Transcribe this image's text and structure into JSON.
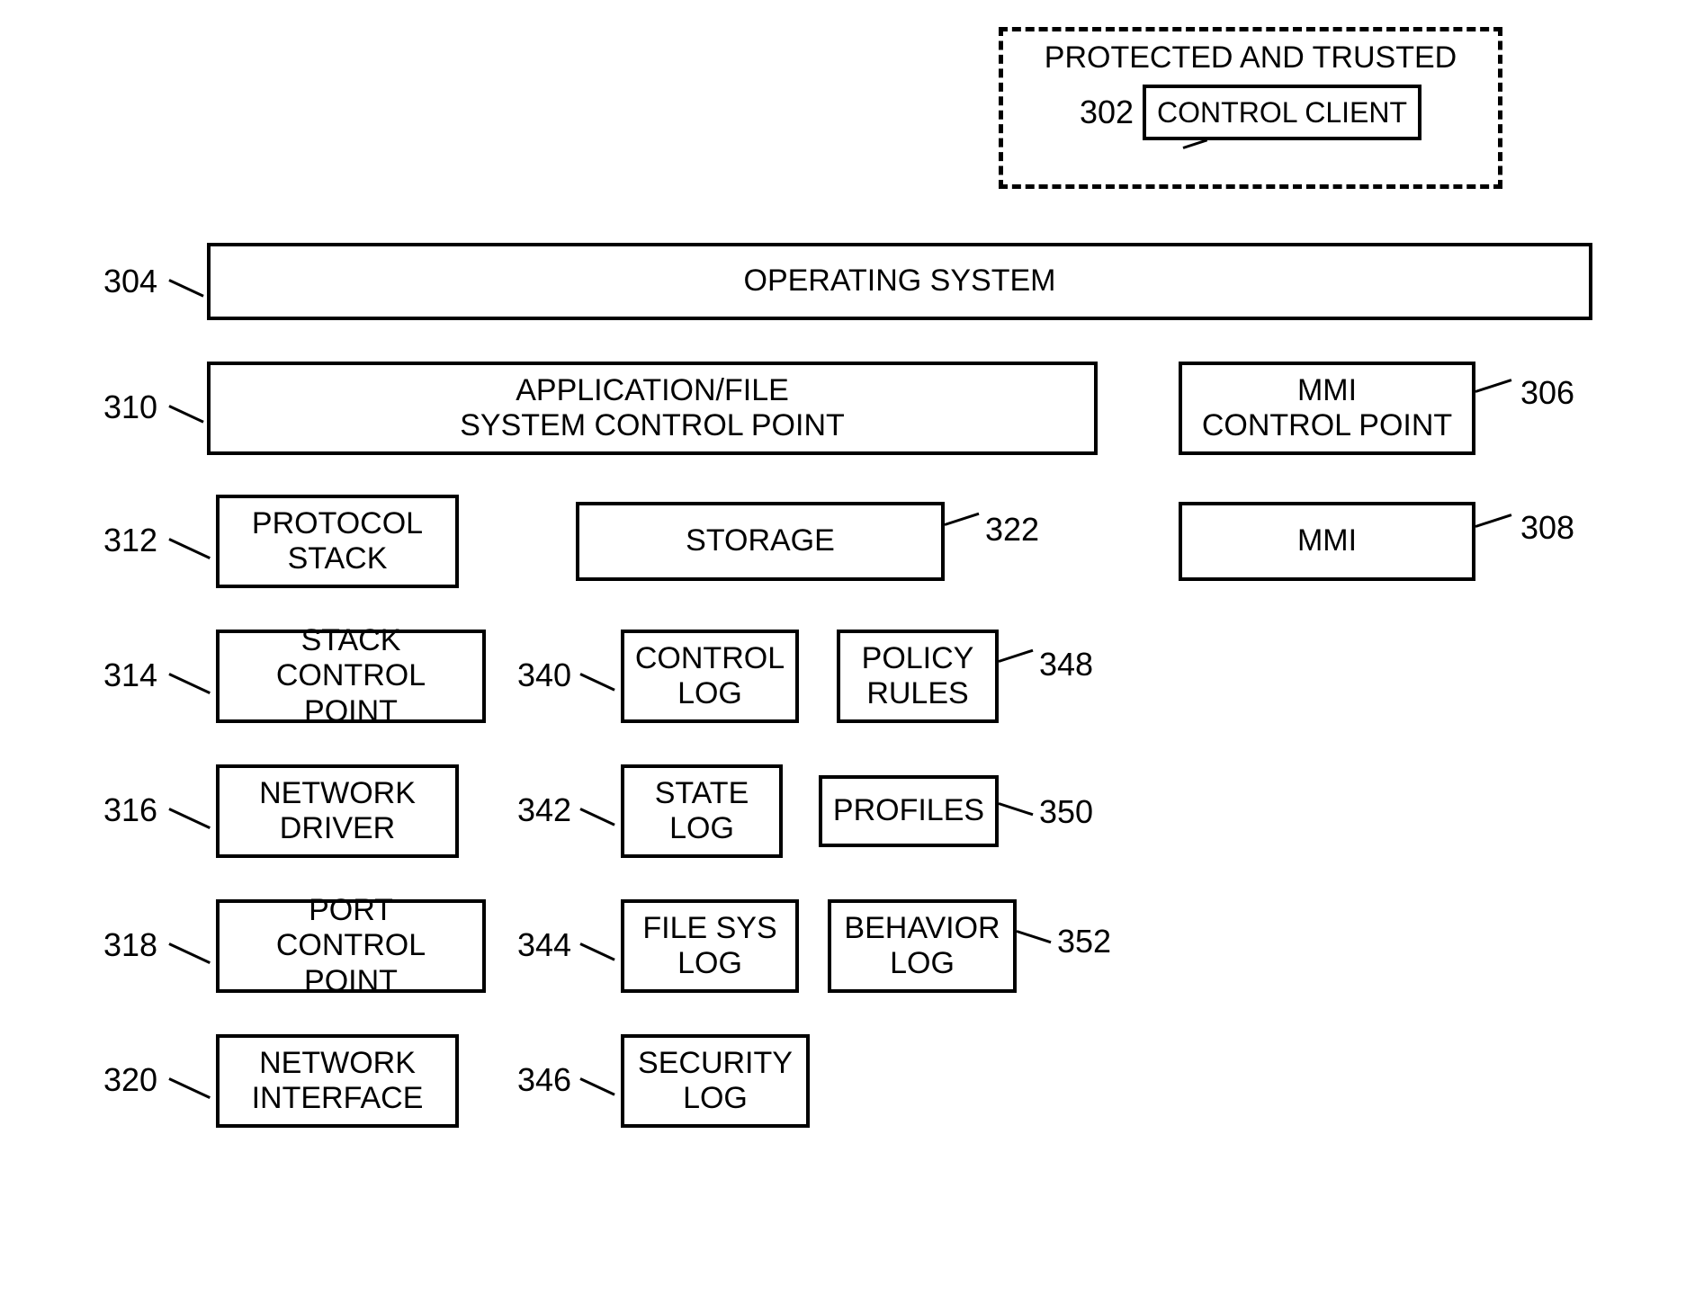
{
  "dashed": {
    "title": "PROTECTED AND TRUSTED",
    "inner_ref": "302",
    "inner_label": "CONTROL CLIENT"
  },
  "blocks": {
    "os": {
      "ref": "304",
      "label": "OPERATING SYSTEM"
    },
    "app_fs_cp": {
      "ref": "310",
      "label": "APPLICATION/FILE\nSYSTEM CONTROL POINT"
    },
    "mmi_cp": {
      "ref": "306",
      "label": "MMI\nCONTROL POINT"
    },
    "proto_stack": {
      "ref": "312",
      "label": "PROTOCOL\nSTACK"
    },
    "storage": {
      "ref": "322",
      "label": "STORAGE"
    },
    "mmi": {
      "ref": "308",
      "label": "MMI"
    },
    "stack_cp": {
      "ref": "314",
      "label": "STACK\nCONTROL POINT"
    },
    "control_log": {
      "ref": "340",
      "label": "CONTROL\nLOG"
    },
    "policy_rules": {
      "ref": "348",
      "label": "POLICY\nRULES"
    },
    "net_driver": {
      "ref": "316",
      "label": "NETWORK\nDRIVER"
    },
    "state_log": {
      "ref": "342",
      "label": "STATE\nLOG"
    },
    "profiles": {
      "ref": "350",
      "label": "PROFILES"
    },
    "port_cp": {
      "ref": "318",
      "label": "PORT\nCONTROL POINT"
    },
    "filesys_log": {
      "ref": "344",
      "label": "FILE SYS\nLOG"
    },
    "behavior_log": {
      "ref": "352",
      "label": "BEHAVIOR\nLOG"
    },
    "net_iface": {
      "ref": "320",
      "label": "NETWORK\nINTERFACE"
    },
    "security_log": {
      "ref": "346",
      "label": "SECURITY\nLOG"
    }
  }
}
